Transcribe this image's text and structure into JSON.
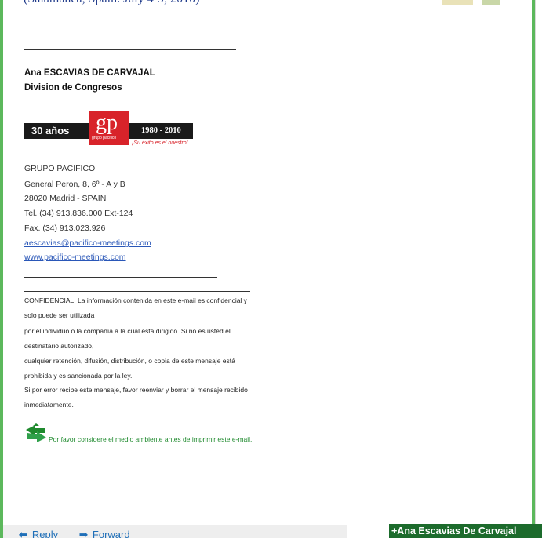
{
  "email": {
    "event_line": "(Salamanca, Spain. July 4-9, 2010)",
    "signature": {
      "name": "Ana ESCAVIAS DE CARVAJAL",
      "department": "Division de Congresos"
    },
    "logo": {
      "years": "30 años",
      "letters": "gp",
      "sub": "grupo pacifico",
      "range": "1980 - 2010",
      "tagline": "¡Su éxito es el nuestro!"
    },
    "address": {
      "company": "GRUPO PACIFICO",
      "street": "General Peron, 8, 6º - A y B",
      "city": "28020 Madrid - SPAIN",
      "tel": "Tel.  (34) 913.836.000 Ext-124",
      "fax": "Fax. (34) 913.023.926",
      "email": "aescavias@pacifico-meetings.com",
      "web": "www.pacifico-meetings.com"
    },
    "confidential": [
      "CONFIDENCIAL. La información contenida en este e-mail es confidencial y",
      "solo puede ser utilizada",
      "por el individuo o la compañía a la cual está dirigido.  Si no es usted el",
      "destinatario autorizado,",
      "cualquier retención, difusión, distribución, o copia de este mensaje está",
      "prohibida y es sancionada por la ley.",
      "Si por error recibe este mensaje, favor reenviar y borrar el mensaje recibido",
      "inmediatamente."
    ],
    "environment_note": "Por favor considere el medio ambiente antes de imprimir este e-mail."
  },
  "actions": {
    "reply": "Reply",
    "forward": "Forward"
  },
  "sender_tab": {
    "label": "+Ana Escavias De Carvajal"
  },
  "colors": {
    "frame": "#5cb85c",
    "link": "#2a57b8",
    "env_text": "#1f8a2e",
    "sender_tab": "#1c6b2c",
    "logo_red": "#d8232a"
  },
  "icons": {
    "reply": "reply-arrow-icon",
    "forward": "forward-arrow-icon",
    "environment": "recycle-arrow-icon"
  }
}
